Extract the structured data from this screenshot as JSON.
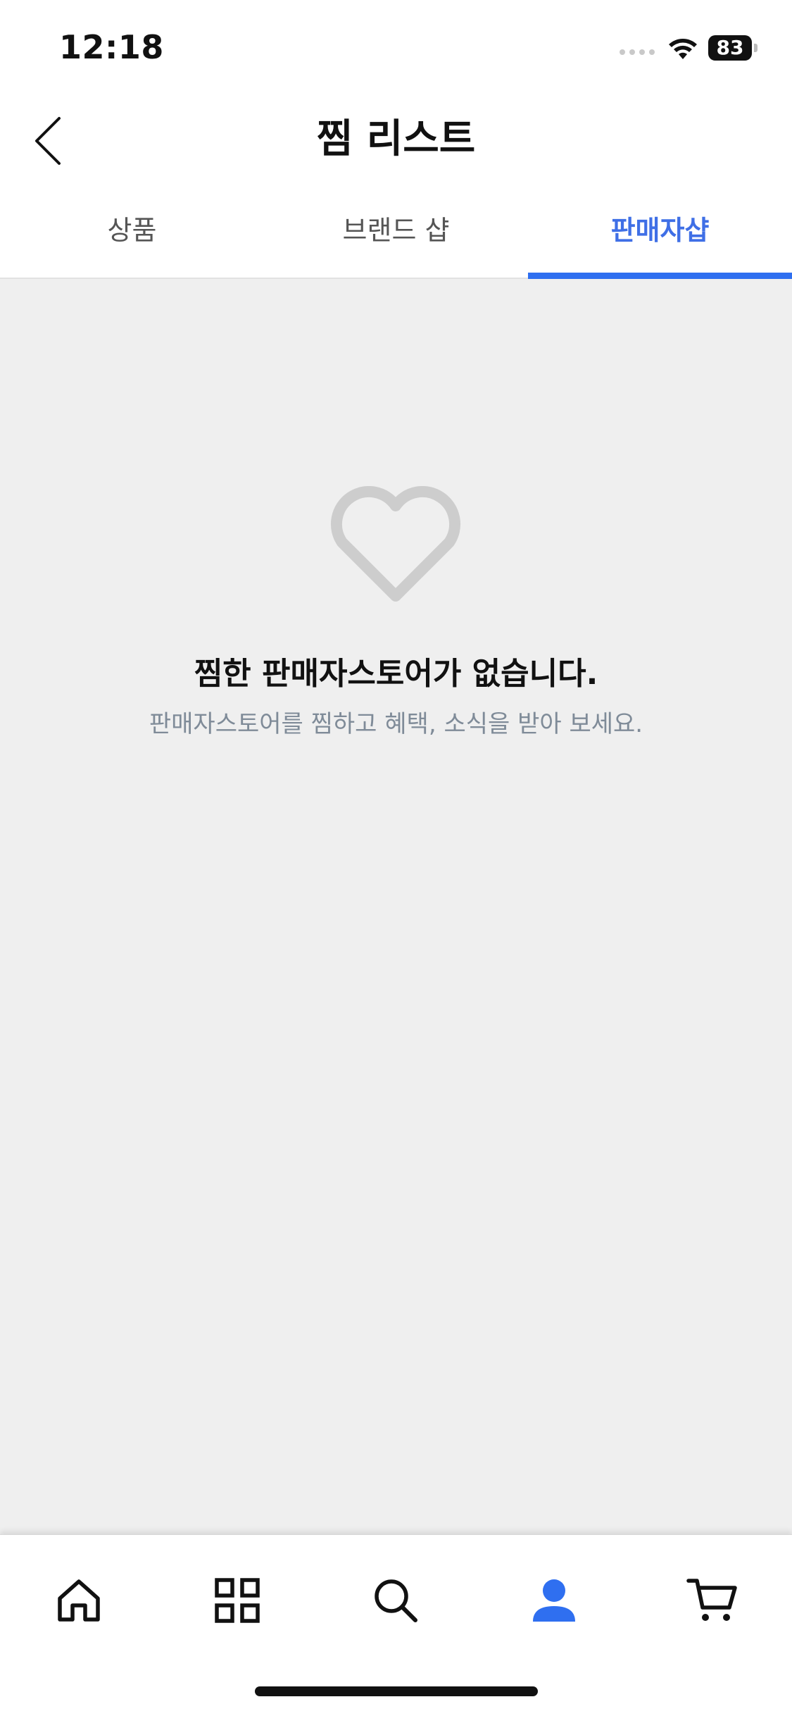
{
  "status_bar": {
    "time": "12:18",
    "battery": "83"
  },
  "header": {
    "title": "찜 리스트",
    "back_icon": "chevron-left-icon"
  },
  "tabs": [
    {
      "label": "상품",
      "active": false
    },
    {
      "label": "브랜드 샵",
      "active": false
    },
    {
      "label": "판매자샵",
      "active": true
    }
  ],
  "empty_state": {
    "icon": "heart-outline-icon",
    "title": "찜한 판매자스토어가 없습니다.",
    "subtitle": "판매자스토어를 찜하고 혜택, 소식을 받아 보세요."
  },
  "bottom_nav": [
    {
      "icon": "home-icon",
      "active": false
    },
    {
      "icon": "category-grid-icon",
      "active": false
    },
    {
      "icon": "search-icon",
      "active": false
    },
    {
      "icon": "profile-icon",
      "active": true
    },
    {
      "icon": "cart-icon",
      "active": false
    }
  ],
  "colors": {
    "accent": "#2f6ff0",
    "active_tab_text": "#3f6fe6",
    "content_background": "#efefef",
    "heart_icon": "#cdcdcd",
    "subtitle_text": "#7f8b98"
  }
}
